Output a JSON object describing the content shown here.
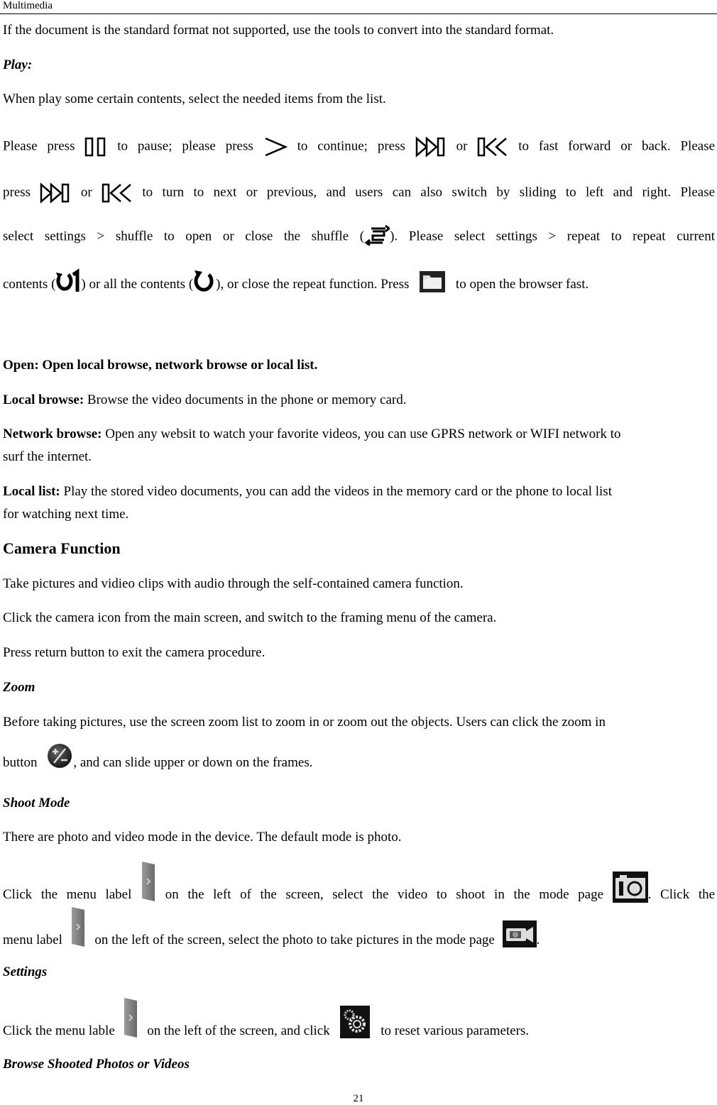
{
  "header": {
    "title": "Multimedia"
  },
  "p_intro": "If the document is the standard format not supported, use the tools to convert into the standard format.",
  "play": {
    "heading": "Play:",
    "line1": "When play some certain contents, select the needed items from the list.",
    "l2_a": "Please press",
    "l2_b": "to pause; please press",
    "l2_c": "to continue; press",
    "l2_d": "or",
    "l2_e": "to fast forward or back. Please",
    "l3_a": "press",
    "l3_b": "or",
    "l3_c": "to turn to next or previous, and users can also switch by sliding to left and right. Please",
    "l4_a": "select settings > shuffle to open or close the shuffle (",
    "l4_b": "). Please select settings > repeat to repeat current",
    "l5_a": "contents (",
    "l5_b": ") or all the contents (",
    "l5_c": "), or close the repeat function. Press",
    "l5_d": "to open the browser fast."
  },
  "open": {
    "line": "Open: Open local browse, network browse or local list.",
    "local_browse_label": "Local browse:",
    "local_browse_text": " Browse the video documents in the phone or memory card.",
    "network_browse_label": "Network browse:",
    "network_browse_text": " Open any websit to watch your favorite videos, you can use GPRS network or WIFI network to",
    "network_browse_text2": "surf the internet.",
    "local_list_label": "Local list:",
    "local_list_text": " Play the stored video documents, you can add the videos in the memory card or the phone to local list",
    "local_list_text2": "for watching next time."
  },
  "camera": {
    "heading": "Camera Function",
    "p1": "Take pictures and vidieo clips with audio through the self-contained camera function.",
    "p2": "Click the camera icon from the main screen, and switch to the framing menu of the camera.",
    "p3": "Press return button to exit the camera procedure."
  },
  "zoom": {
    "heading": "Zoom",
    "l1": "Before taking pictures, use the screen zoom list to zoom in or zoom out the objects. Users can click the zoom in",
    "l2_a": "button",
    "l2_b": ", and can slide upper or down on the frames."
  },
  "shoot_mode": {
    "heading": "Shoot Mode",
    "p1": "There are photo and video mode in the device. The default mode is photo.",
    "l2_a": "Click the menu label",
    "l2_b": "on the left of the screen, select the video to shoot in the mode page",
    "l2_c": ". Click the",
    "l3_a": "menu label",
    "l3_b": "on the left of the screen, select the photo to take pictures in the mode page",
    "l3_c": "."
  },
  "settings": {
    "heading": "Settings",
    "l1_a": "Click the menu lable",
    "l1_b": "on the left of the screen, and click",
    "l1_c": "to reset various parameters."
  },
  "browse": {
    "heading": "Browse Shooted Photos or Videos"
  },
  "footer": {
    "page_number": "21"
  }
}
